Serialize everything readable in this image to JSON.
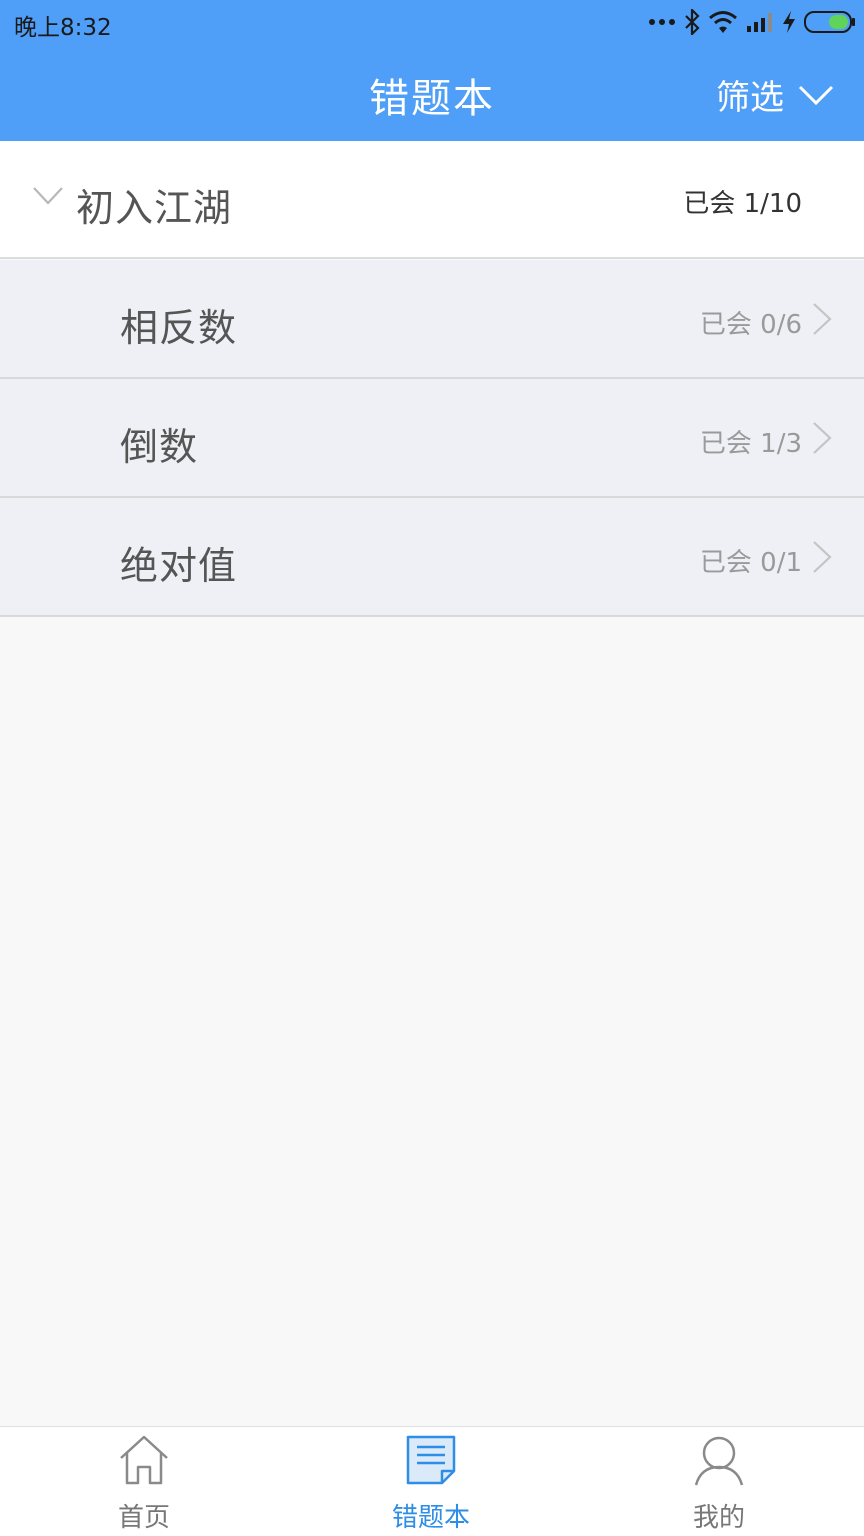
{
  "status_bar": {
    "time": "晚上8:32",
    "icons": [
      "more-dots-icon",
      "bluetooth-icon",
      "wifi-icon",
      "signal-icon",
      "charging-icon",
      "battery-icon"
    ]
  },
  "header": {
    "title": "错题本",
    "filter_label": "筛选",
    "background": "#4f9ef7"
  },
  "group": {
    "title": "初入江湖",
    "progress": "已会 1/10",
    "expanded": true
  },
  "items": [
    {
      "title": "相反数",
      "progress": "已会 0/6"
    },
    {
      "title": "倒数",
      "progress": "已会 1/3"
    },
    {
      "title": "绝对值",
      "progress": "已会 0/1"
    }
  ],
  "tabbar": {
    "tabs": [
      {
        "label": "首页",
        "icon": "home-icon",
        "active": false
      },
      {
        "label": "错题本",
        "icon": "notebook-icon",
        "active": true
      },
      {
        "label": "我的",
        "icon": "user-icon",
        "active": false
      }
    ],
    "active_color": "#2e8de6"
  }
}
